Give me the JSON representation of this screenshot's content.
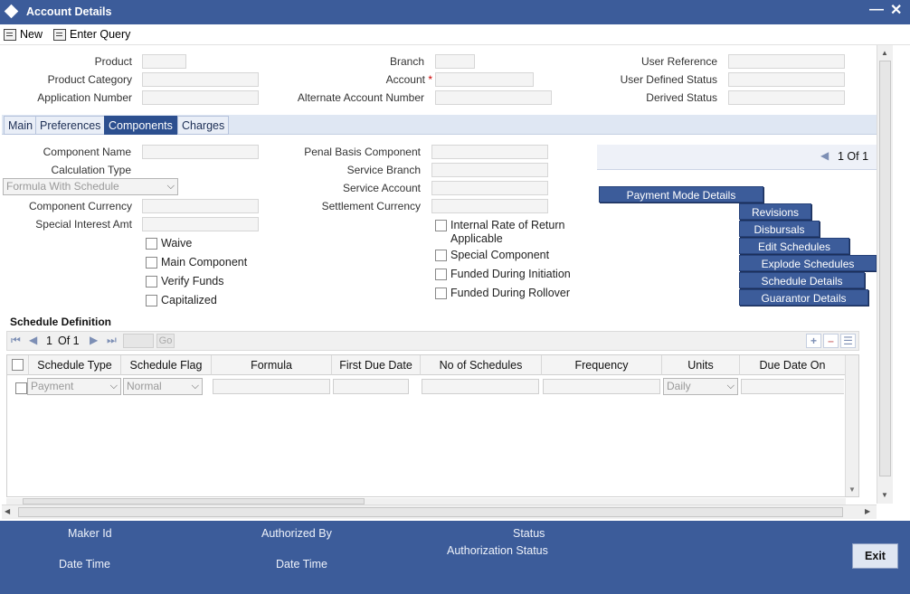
{
  "window": {
    "title": "Account Details",
    "minimize_label": "—",
    "close_label": "✕"
  },
  "toolbar": {
    "new_label": "New",
    "enter_query_label": "Enter Query"
  },
  "header": {
    "product_label": "Product",
    "product_category_label": "Product Category",
    "application_number_label": "Application Number",
    "branch_label": "Branch",
    "account_label": "Account",
    "required_mark": "*",
    "alternate_account_number_label": "Alternate Account Number",
    "user_reference_label": "User Reference",
    "user_defined_status_label": "User Defined Status",
    "derived_status_label": "Derived Status"
  },
  "tabs": [
    "Main",
    "Preferences",
    "Components",
    "Charges"
  ],
  "components": {
    "component_name_label": "Component Name",
    "calculation_type_label": "Calculation Type",
    "calculation_type_value": "Formula With Schedule",
    "component_currency_label": "Component Currency",
    "special_interest_amt_label": "Special Interest Amt",
    "penal_basis_component_label": "Penal Basis Component",
    "service_branch_label": "Service Branch",
    "service_account_label": "Service Account",
    "settlement_currency_label": "Settlement Currency",
    "checkboxes_left": [
      "Waive",
      "Main Component",
      "Verify Funds",
      "Capitalized"
    ],
    "irr_label_line1": "Internal Rate of Return",
    "irr_label_line2": "Applicable",
    "checkboxes_right": [
      "Special Component",
      "Funded During Initiation",
      "Funded During Rollover"
    ],
    "pager_text": "1 Of 1",
    "payment_mode_details_label": "Payment Mode Details",
    "revisions_label": "Revisions",
    "disbursals_label": "Disbursals",
    "edit_schedules_label": "Edit Schedules",
    "explode_schedules_label": "Explode Schedules",
    "schedule_details_label": "Schedule Details",
    "guarantor_details_label": "Guarantor Details"
  },
  "schedule": {
    "title": "Schedule Definition",
    "pager_current": "1",
    "pager_of": "Of 1",
    "go_label": "Go",
    "columns": [
      "Schedule Type",
      "Schedule Flag",
      "Formula",
      "First Due Date",
      "No of Schedules",
      "Frequency",
      "Units",
      "Due Date On"
    ],
    "row": {
      "schedule_type": "Payment",
      "schedule_flag": "Normal",
      "units": "Daily"
    }
  },
  "footer": {
    "maker_id_label": "Maker Id",
    "date_time_label": "Date Time",
    "authorized_by_label": "Authorized By",
    "checker_date_time_label": "Date Time",
    "status_label": "Status",
    "authorization_status_label": "Authorization Status",
    "exit_label": "Exit"
  },
  "colors": {
    "brand_blue": "#3c5c9a",
    "tab_active": "#2c4f8f"
  }
}
